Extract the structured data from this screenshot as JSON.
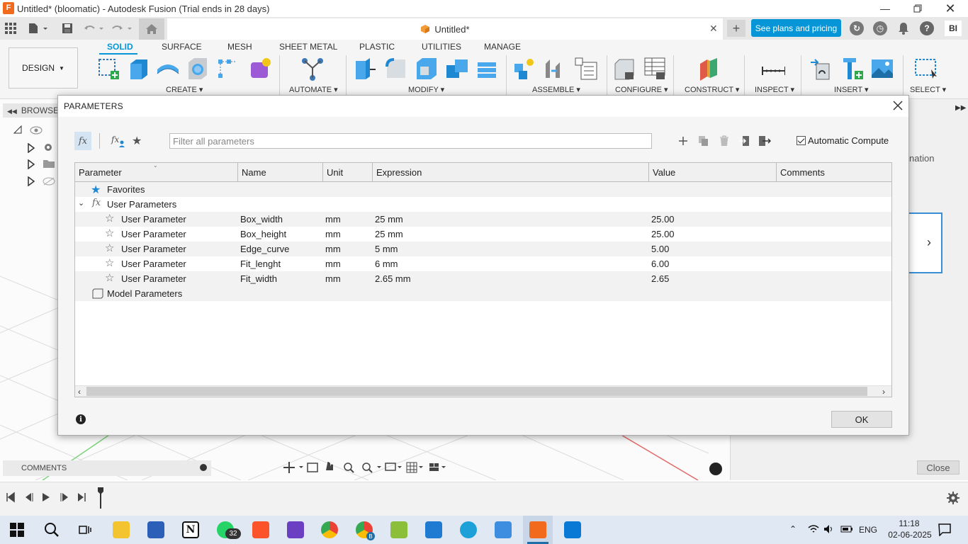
{
  "window": {
    "title": "Untitled* (bloomatic) - Autodesk Fusion (Trial ends in 28 days)",
    "app_icon_letter": "F"
  },
  "document_tab": {
    "label": "Untitled*"
  },
  "header": {
    "plans_button": "See plans and pricing",
    "user_initials": "BI"
  },
  "workspace": {
    "label": "DESIGN"
  },
  "ribbon": {
    "tabs": [
      "SOLID",
      "SURFACE",
      "MESH",
      "SHEET METAL",
      "PLASTIC",
      "UTILITIES",
      "MANAGE"
    ],
    "active_tab": "SOLID",
    "groups": [
      "CREATE",
      "AUTOMATE",
      "MODIFY",
      "ASSEMBLE",
      "CONFIGURE",
      "CONSTRUCT",
      "INSPECT",
      "INSERT",
      "SELECT"
    ]
  },
  "browser": {
    "title": "BROWSER"
  },
  "right_panel": {
    "partial_text": "nation",
    "close_button": "Close"
  },
  "comments": {
    "label": "COMMENTS"
  },
  "dialog": {
    "title": "PARAMETERS",
    "search_placeholder": "Filter all parameters",
    "auto_compute_label": "Automatic Compute",
    "auto_compute_checked": true,
    "columns": [
      "Parameter",
      "Name",
      "Unit",
      "Expression",
      "Value",
      "Comments"
    ],
    "groups": {
      "favorites": "Favorites",
      "user_parameters": "User Parameters",
      "model_parameters": "Model Parameters"
    },
    "rows": [
      {
        "parameter": "User Parameter",
        "name": "Box_width",
        "unit": "mm",
        "expression": "25 mm",
        "value": "25.00",
        "comments": ""
      },
      {
        "parameter": "User Parameter",
        "name": "Box_height",
        "unit": "mm",
        "expression": "25 mm",
        "value": "25.00",
        "comments": ""
      },
      {
        "parameter": "User Parameter",
        "name": "Edge_curve",
        "unit": "mm",
        "expression": "5 mm",
        "value": "5.00",
        "comments": ""
      },
      {
        "parameter": "User Parameter",
        "name": "Fit_lenght",
        "unit": "mm",
        "expression": "6 mm",
        "value": "6.00",
        "comments": ""
      },
      {
        "parameter": "User Parameter",
        "name": "Fit_width",
        "unit": "mm",
        "expression": "2.65 mm",
        "value": "2.65",
        "comments": ""
      }
    ],
    "ok_button": "OK"
  },
  "taskbar": {
    "whatsapp_badge": "32",
    "chrome_badge": "B",
    "language": "ENG",
    "time": "11:18",
    "date": "02-06-2025"
  },
  "colors": {
    "accent": "#0696d7",
    "fusion_orange": "#f26b1d",
    "row_alt": "#f2f2f2"
  }
}
